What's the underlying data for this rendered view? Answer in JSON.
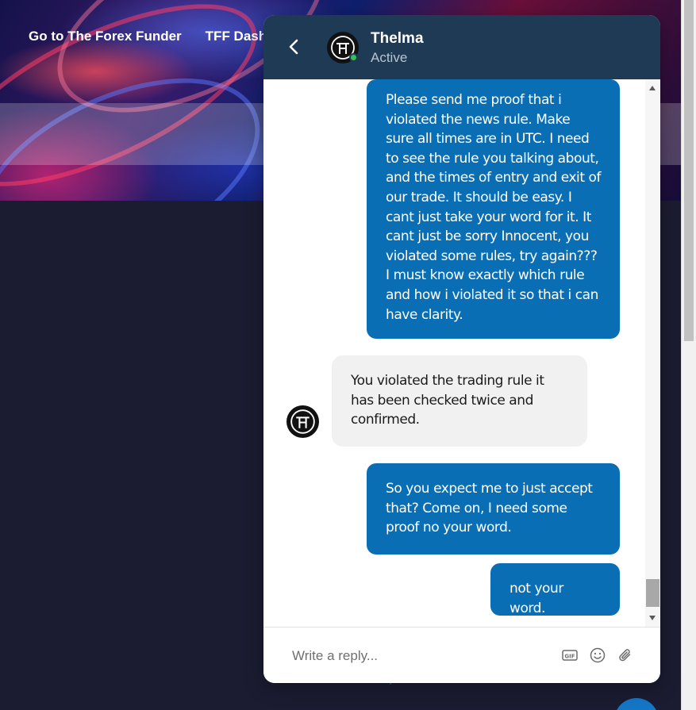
{
  "page": {
    "nav": [
      "Go to The Forex Funder",
      "TFF Dashb"
    ]
  },
  "chat": {
    "header": {
      "agent_name": "Thelma",
      "status": "Active"
    },
    "messages": [
      {
        "direction": "outgoing",
        "text": "Please send me proof that i violated the news rule. Make sure all times are in UTC. I need to see the rule you talking about, and the times of entry and exit of our trade. It should be easy. I cant just take your word for it. It cant just be sorry Innocent, you violated some rules, try again??? I must know exactly which rule and how i violated it so that i can have clarity."
      },
      {
        "direction": "incoming",
        "text": "You violated the trading rule it has been checked twice and confirmed."
      },
      {
        "direction": "outgoing",
        "text": "So you expect me to just accept that? Come on, I need some proof no your word."
      },
      {
        "direction": "outgoing",
        "text": "not your word."
      }
    ],
    "composer": {
      "placeholder": "Write a reply..."
    },
    "icons": {
      "back": "chevron-left-icon",
      "gif": "gif-icon",
      "emoji": "emoji-icon",
      "attach": "paperclip-icon"
    },
    "colors": {
      "header_bg": "#1e3a54",
      "outgoing_bubble": "#0a6eb5",
      "incoming_bubble": "#f1f1f1",
      "online": "#33c24d"
    }
  }
}
